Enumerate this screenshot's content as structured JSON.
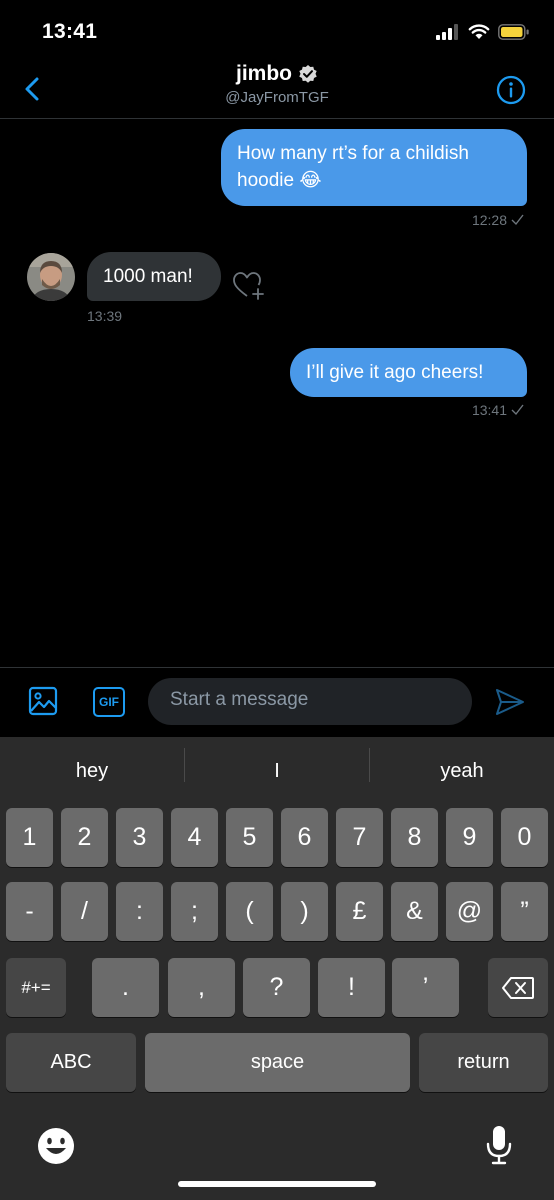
{
  "status_bar": {
    "time": "13:41"
  },
  "header": {
    "name": "jimbo",
    "handle": "@JayFromTGF"
  },
  "messages": [
    {
      "line1": "How many rt’s for a childish",
      "line2": "hoodie 😂",
      "time": "12:28"
    },
    {
      "text": "1000 man!",
      "time": "13:39"
    },
    {
      "text": "I’ll give it ago cheers!",
      "time": "13:41"
    }
  ],
  "composer": {
    "placeholder": "Start a message",
    "gif_label": "GIF"
  },
  "keyboard": {
    "suggestions": [
      "hey",
      "I",
      "yeah"
    ],
    "row1": [
      "1",
      "2",
      "3",
      "4",
      "5",
      "6",
      "7",
      "8",
      "9",
      "0"
    ],
    "row2": [
      "-",
      "/",
      ":",
      ";",
      "(",
      ")",
      "£",
      "&",
      "@",
      "”"
    ],
    "row3": [
      ".",
      ",",
      "?",
      "!",
      "’"
    ],
    "symbols_label": "#+=",
    "abc_label": "ABC",
    "space_label": "space",
    "return_label": "return"
  },
  "colors": {
    "accent": "#1d9bf0",
    "bubble_out": "#4a99e9",
    "bubble_in": "#2f3336"
  }
}
